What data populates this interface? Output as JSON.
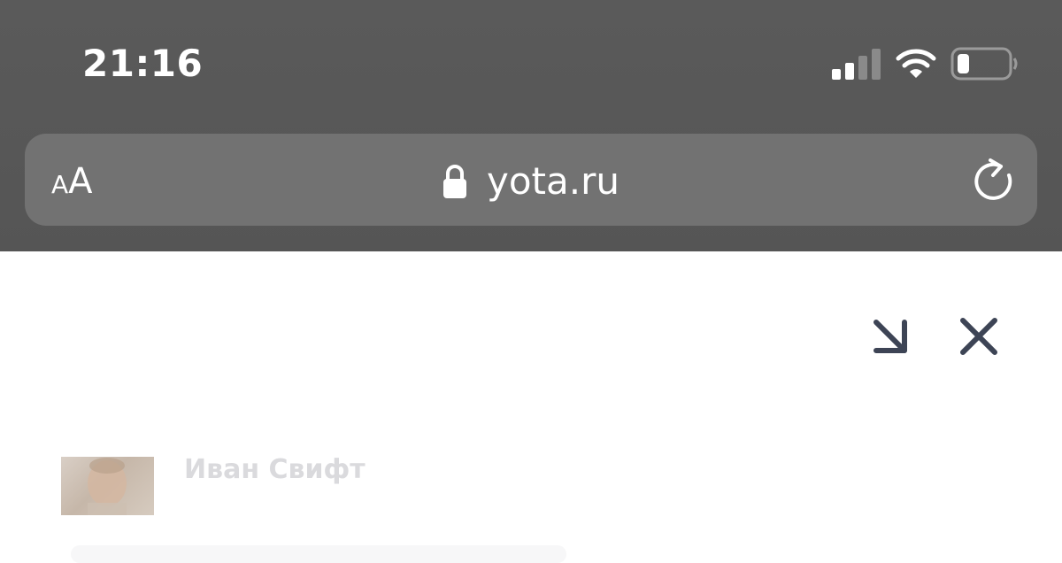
{
  "status_bar": {
    "time": "21:16",
    "signal_icon": "cellular-signal-icon",
    "wifi_icon": "wifi-icon",
    "battery_icon": "battery-low-icon"
  },
  "address_bar": {
    "text_size_label_small": "A",
    "text_size_label_large": "A",
    "url": "yota.ru",
    "lock_icon": "lock-icon",
    "reload_icon": "reload-icon"
  },
  "chat_window": {
    "minimize_icon": "arrow-down-right-icon",
    "close_icon": "close-icon",
    "agent_name": "Иван Свифт",
    "icon_color": "#3d4455"
  },
  "colors": {
    "browser_chrome": "#585858",
    "address_field": "#727272",
    "page_background": "#ffffff"
  }
}
